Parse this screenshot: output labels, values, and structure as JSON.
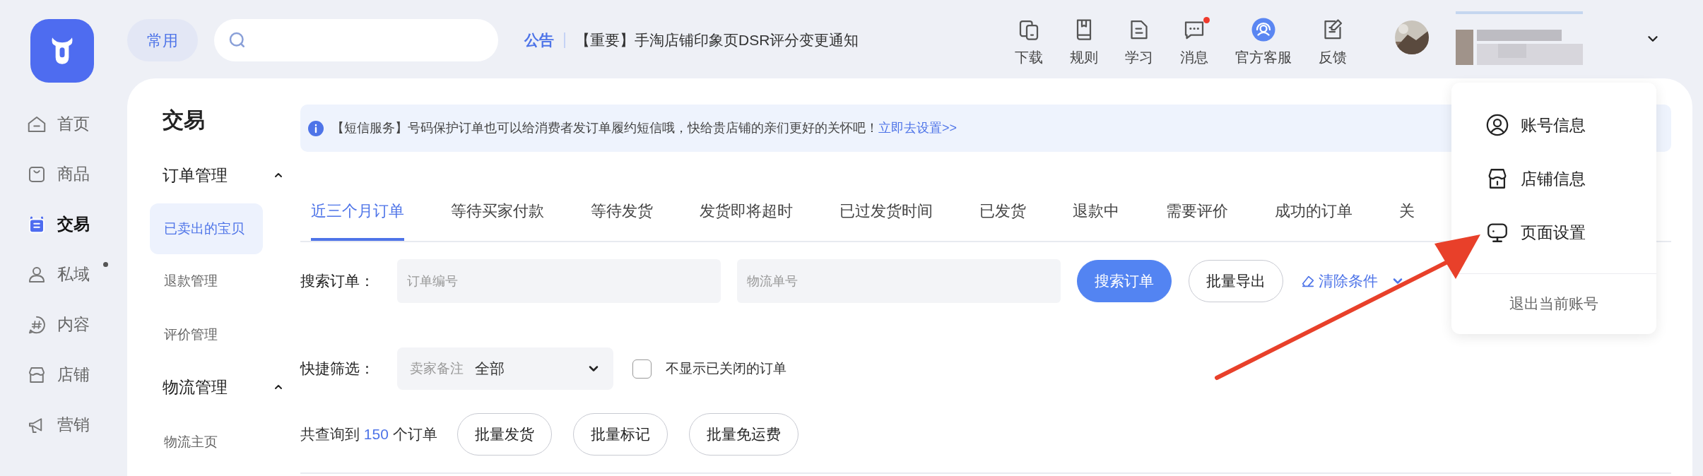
{
  "top_bar": {
    "quick_button": "常用",
    "notice": {
      "label": "公告",
      "text": "【重要】手淘店铺印象页DSR评分变更通知"
    },
    "tools": [
      {
        "label": "下载",
        "unread": false
      },
      {
        "label": "规则",
        "unread": false
      },
      {
        "label": "学习",
        "unread": false
      },
      {
        "label": "消息",
        "unread": true
      },
      {
        "label": "官方客服",
        "unread": false
      },
      {
        "label": "反馈",
        "unread": false
      }
    ]
  },
  "sidebar": {
    "items": [
      {
        "label": "首页",
        "selected": false,
        "unread": false
      },
      {
        "label": "商品",
        "selected": false,
        "unread": false
      },
      {
        "label": "交易",
        "selected": true,
        "unread": false
      },
      {
        "label": "私域",
        "selected": false,
        "unread": true
      },
      {
        "label": "内容",
        "selected": false,
        "unread": false
      },
      {
        "label": "店铺",
        "selected": false,
        "unread": false
      },
      {
        "label": "营销",
        "selected": false,
        "unread": false
      }
    ]
  },
  "subnav": {
    "title": "交易",
    "groups": [
      {
        "label": "订单管理",
        "expanded": true,
        "children": [
          {
            "label": "已卖出的宝贝",
            "selected": true
          },
          {
            "label": "退款管理",
            "selected": false
          },
          {
            "label": "评价管理",
            "selected": false
          }
        ]
      },
      {
        "label": "物流管理",
        "expanded": true,
        "children": [
          {
            "label": "物流主页",
            "selected": false
          }
        ]
      }
    ]
  },
  "banner": {
    "text": "【短信服务】号码保护订单也可以给消费者发订单履约短信哦，快给贵店铺的亲们更好的关怀吧！",
    "link": "立即去设置>>"
  },
  "tabs": [
    {
      "label": "近三个月订单",
      "selected": true
    },
    {
      "label": "等待买家付款",
      "selected": false
    },
    {
      "label": "等待发货",
      "selected": false
    },
    {
      "label": "发货即将超时",
      "selected": false
    },
    {
      "label": "已过发货时间",
      "selected": false
    },
    {
      "label": "已发货",
      "selected": false
    },
    {
      "label": "退款中",
      "selected": false
    },
    {
      "label": "需要评价",
      "selected": false
    },
    {
      "label": "成功的订单",
      "selected": false
    },
    {
      "label": "关",
      "selected": false
    }
  ],
  "search_row": {
    "label": "搜索订单：",
    "fields": [
      {
        "placeholder": "订单编号"
      },
      {
        "placeholder": "物流单号"
      }
    ],
    "buttons": [
      {
        "label": "搜索订单",
        "kind": "primary"
      },
      {
        "label": "批量导出",
        "kind": "outline"
      }
    ],
    "clear_link": "清除条件"
  },
  "quick_filter": {
    "label": "快捷筛选：",
    "select": {
      "label": "卖家备注",
      "value": "全部"
    },
    "checkbox": {
      "label": "不显示已关闭的订单",
      "checked": false
    }
  },
  "result": {
    "prefix": "共查询到",
    "count": "150",
    "suffix": "个订单",
    "buttons": [
      "批量发货",
      "批量标记",
      "批量免运费"
    ]
  },
  "account_menu": {
    "items": [
      "账号信息",
      "店铺信息",
      "页面设置"
    ],
    "logout": "退出当前账号"
  }
}
